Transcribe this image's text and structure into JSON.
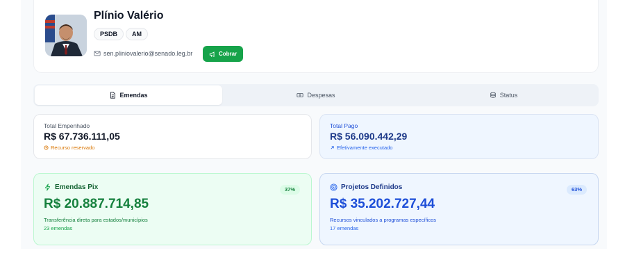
{
  "profile": {
    "name": "Plínio Valério",
    "party": "PSDB",
    "state": "AM",
    "email": "sen.pliniovalerio@senado.leg.br",
    "cobrar_label": "Cobrar"
  },
  "tabs": [
    {
      "label": "Emendas",
      "icon": "document-icon",
      "active": true
    },
    {
      "label": "Despesas",
      "icon": "banknote-icon",
      "active": false
    },
    {
      "label": "Status",
      "icon": "database-icon",
      "active": false
    }
  ],
  "stats": {
    "empenhado": {
      "label": "Total Empenhado",
      "value": "R$ 67.736.111,05",
      "note": "Recurso reservado"
    },
    "pago": {
      "label": "Total Pago",
      "value": "R$ 56.090.442,29",
      "note": "Efetivamente executado"
    }
  },
  "cards": {
    "pix": {
      "title": "Emendas Pix",
      "percent": "37%",
      "amount": "R$ 20.887.714,85",
      "description": "Transferência direta para estados/municípios",
      "count": "23 emendas"
    },
    "projetos": {
      "title": "Projetos Definidos",
      "percent": "63%",
      "amount": "R$ 35.202.727,44",
      "description": "Recursos vinculados a programas específicos",
      "count": "17 emendas"
    }
  },
  "colors": {
    "green_accent": "#16a34a",
    "blue_accent": "#1d4ed8",
    "amber_note": "#d97706"
  }
}
